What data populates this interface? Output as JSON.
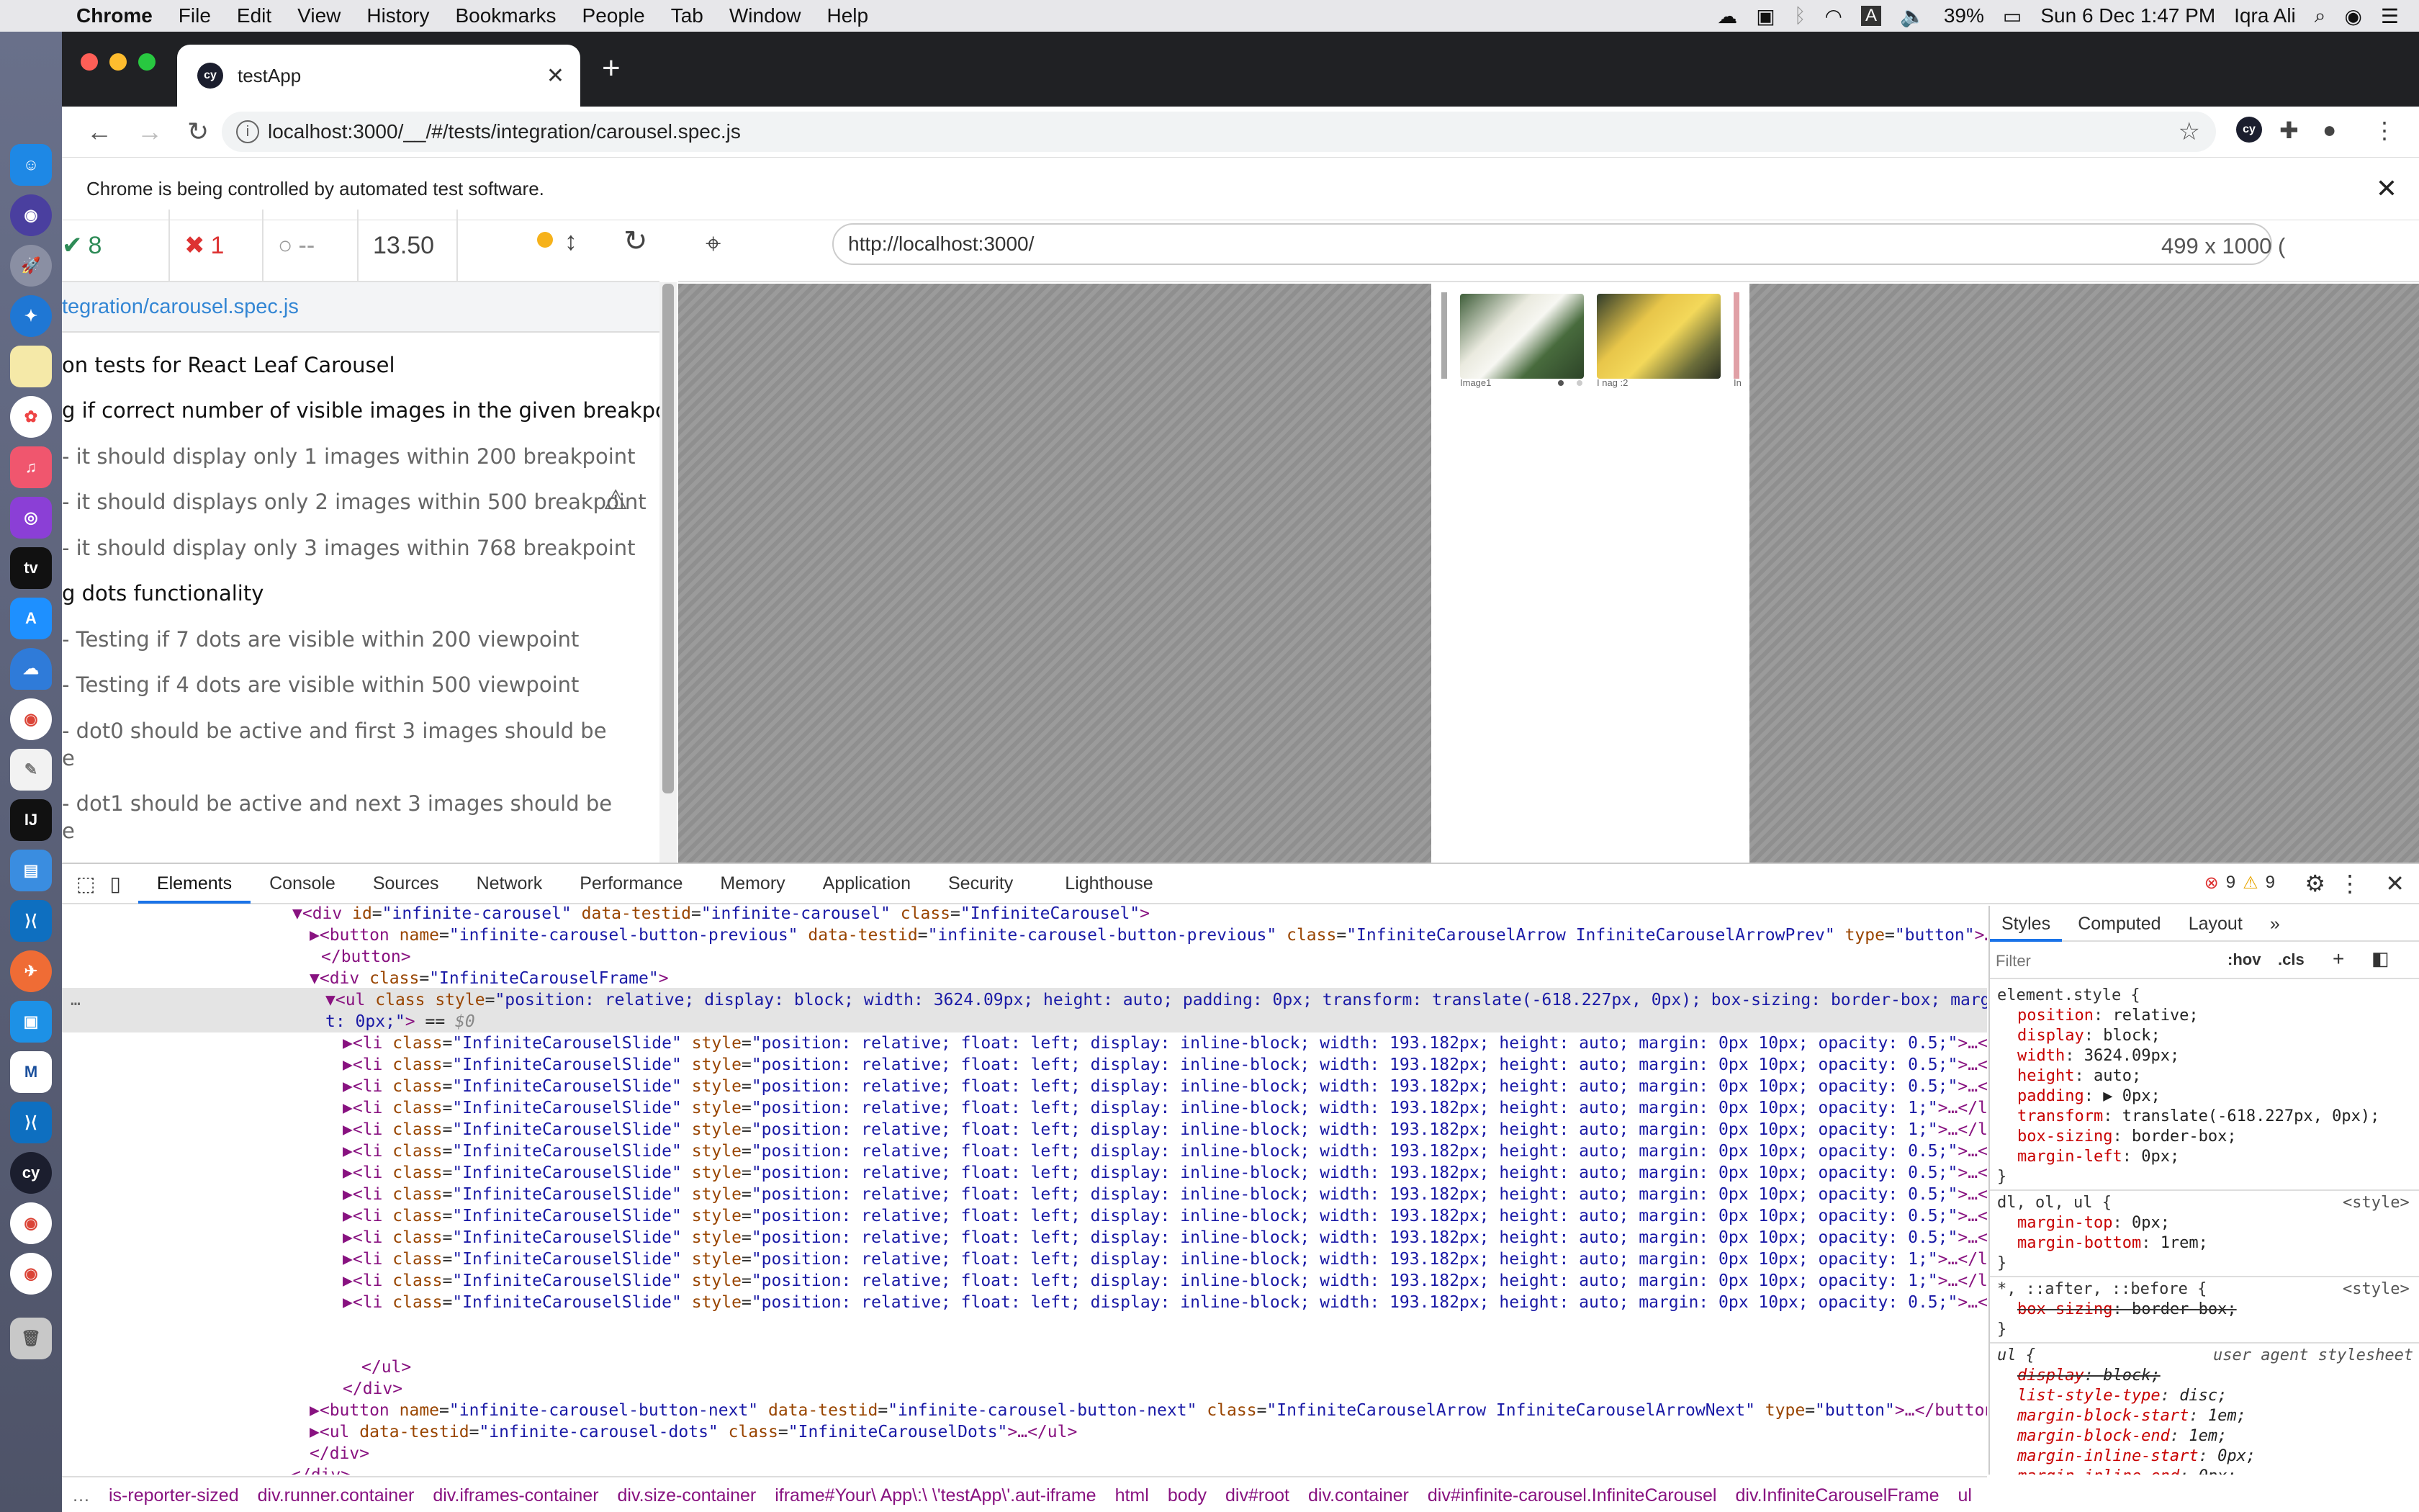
{
  "menubar": {
    "app": "Chrome",
    "items": [
      "File",
      "Edit",
      "View",
      "History",
      "Bookmarks",
      "People",
      "Tab",
      "Window",
      "Help"
    ],
    "battery": "39%",
    "datetime": "Sun 6 Dec  1:47 PM",
    "user": "Iqra Ali"
  },
  "browser": {
    "tab_title": "testApp",
    "tab_favicon": "cy",
    "url": "localhost:3000/__/#/tests/integration/carousel.spec.js",
    "infobar_text": "Chrome is being controlled by automated test software."
  },
  "runner": {
    "passed": "8",
    "failed": "1",
    "pending": "--",
    "duration": "13.50",
    "spec_file": "tegration/carousel.spec.js",
    "aut_url": "http://localhost:3000/",
    "viewport": "499 x 1000  (",
    "rows": [
      {
        "text": "on tests for React Leaf Carousel",
        "kind": "suite"
      },
      {
        "text": "g if correct number of visible images in the given breakpoint",
        "kind": "suite"
      },
      {
        "text": "- it should display only 1 images within 200 breakpoint",
        "kind": "test"
      },
      {
        "text": "- it should displays only 2 images within 500 breakpoint",
        "kind": "test"
      },
      {
        "text": "- it should display only 3 images within 768 breakpoint",
        "kind": "test"
      },
      {
        "text": "g dots functionality",
        "kind": "suite"
      },
      {
        "text": "- Testing if 7 dots are visible within 200 viewpoint",
        "kind": "test"
      },
      {
        "text": "- Testing if 4 dots are visible within 500 viewpoint",
        "kind": "test"
      },
      {
        "text": "- dot0 should be active and first 3 images should be",
        "kind": "test"
      },
      {
        "text": "e",
        "kind": "test"
      },
      {
        "text": "- dot1 should be active and next 3 images should be",
        "kind": "test"
      },
      {
        "text": "e",
        "kind": "test"
      }
    ],
    "captions": [
      "Image1",
      "I nag :2",
      "In"
    ]
  },
  "devtools": {
    "tabs": [
      "Elements",
      "Console",
      "Sources",
      "Network",
      "Performance",
      "Memory",
      "Application",
      "Security",
      "Lighthouse"
    ],
    "errors": "9",
    "warnings": "9",
    "style_tabs": [
      "Styles",
      "Computed",
      "Layout"
    ],
    "filter_placeholder": "Filter",
    "hov": ":hov",
    "cls": ".cls",
    "crumbs": [
      "is-reporter-sized",
      "div.runner.container",
      "div.iframes-container",
      "div.size-container",
      "iframe#Your\\ App\\:\\ \\'testApp\\'.aut-iframe",
      "html",
      "body",
      "div#root",
      "div.container",
      "div#infinite-carousel.InfiniteCarousel",
      "div.InfiniteCarouselFrame",
      "ul"
    ]
  }
}
